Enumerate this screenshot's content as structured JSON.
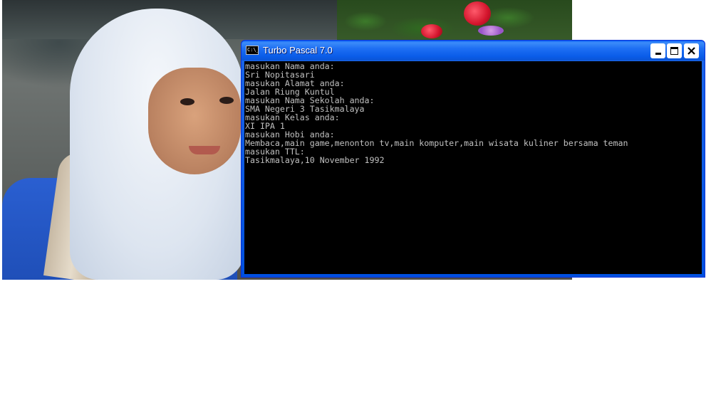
{
  "window": {
    "title": "Turbo Pascal 7.0",
    "icon": "console-icon",
    "icon_text": "C:\\_",
    "controls": {
      "minimize": "minimize-icon",
      "maximize": "maximize-icon",
      "close": "close-icon"
    }
  },
  "console": {
    "lines": [
      "masukan Nama anda:",
      "Sri Nopitasari",
      "masukan Alamat anda:",
      "Jalan Riung Kuntul",
      "masukan Nama Sekolah anda:",
      "SMA Negeri 3 Tasikmalaya",
      "masukan Kelas anda:",
      "XI IPA 1",
      "masukan Hobi anda:",
      "Membaca,main game,menonton tv,main komputer,main wisata kuliner bersama teman",
      "masukan TTL:",
      "Tasikmalaya,10 November 1992"
    ]
  },
  "colors": {
    "titlebar": "#0a5ce8",
    "console_bg": "#000000",
    "console_text": "#c0c0c0"
  }
}
